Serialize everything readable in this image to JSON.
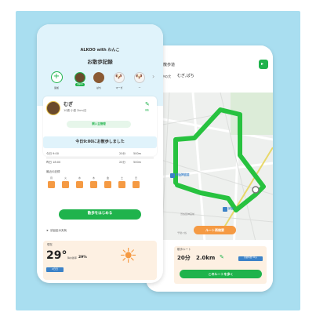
{
  "home": {
    "app_title": "ALKOO with わんこ",
    "section_title": "お散歩記録",
    "add_label": "追加",
    "dogs": [
      {
        "name": "むぎ",
        "badge": "選択中"
      },
      {
        "name": "ぱち"
      },
      {
        "name": "マーガ"
      },
      {
        "name": "ー"
      }
    ],
    "profile": {
      "name": "むぎ",
      "details": "10歳 小型 2km/日",
      "edit_label": "編集",
      "manage_button": "飼い主管理"
    },
    "today_message": "今日9:00にお散歩しました",
    "walks": [
      {
        "label": "今日 9:00",
        "duration": "20分",
        "distance": "500m"
      },
      {
        "label": "昨日 18:00",
        "duration": "20分",
        "distance": "500m"
      }
    ],
    "recent_title": "最近の記録",
    "weekdays": [
      "月",
      "火",
      "水",
      "木",
      "金",
      "土",
      "日"
    ],
    "start_button": "散歩をはじめる",
    "weather": {
      "header": "渋谷区の天気",
      "now_label": "現在",
      "temperature": "29°",
      "rain_label": "降水確率",
      "rain_value": "29%",
      "bottom_tag": "2日日"
    }
  },
  "map": {
    "header_title": "散歩道",
    "sub_label": "選択中の犬",
    "selected_dog": "むぎ,ぱち",
    "station_label": "明治神宮前",
    "metro_label": "渋谷",
    "address_lines": [
      "渋谷区神宮前",
      "千駄ヶ谷"
    ],
    "search_button": "ルート再検索",
    "route_title": "散歩ルート",
    "route_duration": "20分",
    "route_distance": "2.0km",
    "route_badge": "所要時間 30分",
    "walk_route_button": "このルートを歩く"
  },
  "colors": {
    "green": "#1fb34c",
    "orange": "#f59a43",
    "panel_bg": "#a9def0",
    "route": "#27c23f"
  }
}
